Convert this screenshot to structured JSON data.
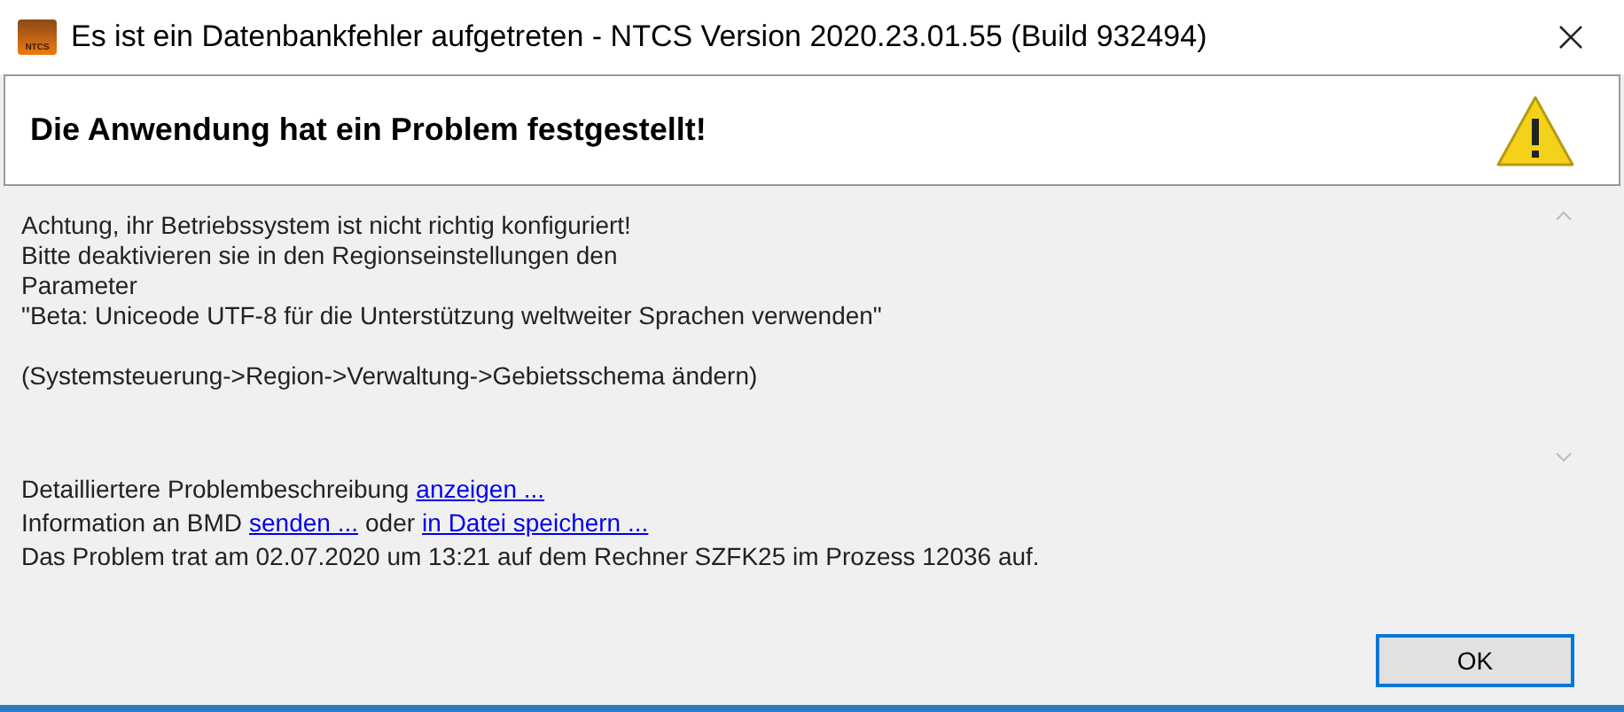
{
  "window": {
    "title": "Es ist ein Datenbankfehler aufgetreten - NTCS Version 2020.23.01.55 (Build 932494)",
    "app_icon_text": "NTCS"
  },
  "header": {
    "title": "Die Anwendung hat ein Problem festgestellt!"
  },
  "message": {
    "paragraphs": [
      [
        "Achtung, ihr Betriebssystem ist nicht richtig konfiguriert!",
        "Bitte deaktivieren sie in den Regionseinstellungen den",
        "Parameter",
        "\"Beta: Uniceode UTF-8 für die Unterstützung weltweiter Sprachen verwenden\""
      ],
      [
        "(Systemsteuerung->Region->Verwaltung->Gebietsschema ändern)"
      ]
    ]
  },
  "info_lines": [
    [
      {
        "kind": "text",
        "text": "Detailliertere Problembeschreibung"
      },
      {
        "kind": "link",
        "text": "anzeigen ..."
      }
    ],
    [
      {
        "kind": "text",
        "text": "Information an BMD"
      },
      {
        "kind": "link",
        "text": "senden ..."
      },
      {
        "kind": "text",
        "text": "oder"
      },
      {
        "kind": "link",
        "text": "in Datei speichern ..."
      }
    ],
    [
      {
        "kind": "text",
        "text": "Das Problem trat am 02.07.2020 um 13:21 auf dem Rechner SZFK25 im Prozess 12036 auf."
      }
    ]
  ],
  "buttons": [
    {
      "label": "OK"
    }
  ]
}
